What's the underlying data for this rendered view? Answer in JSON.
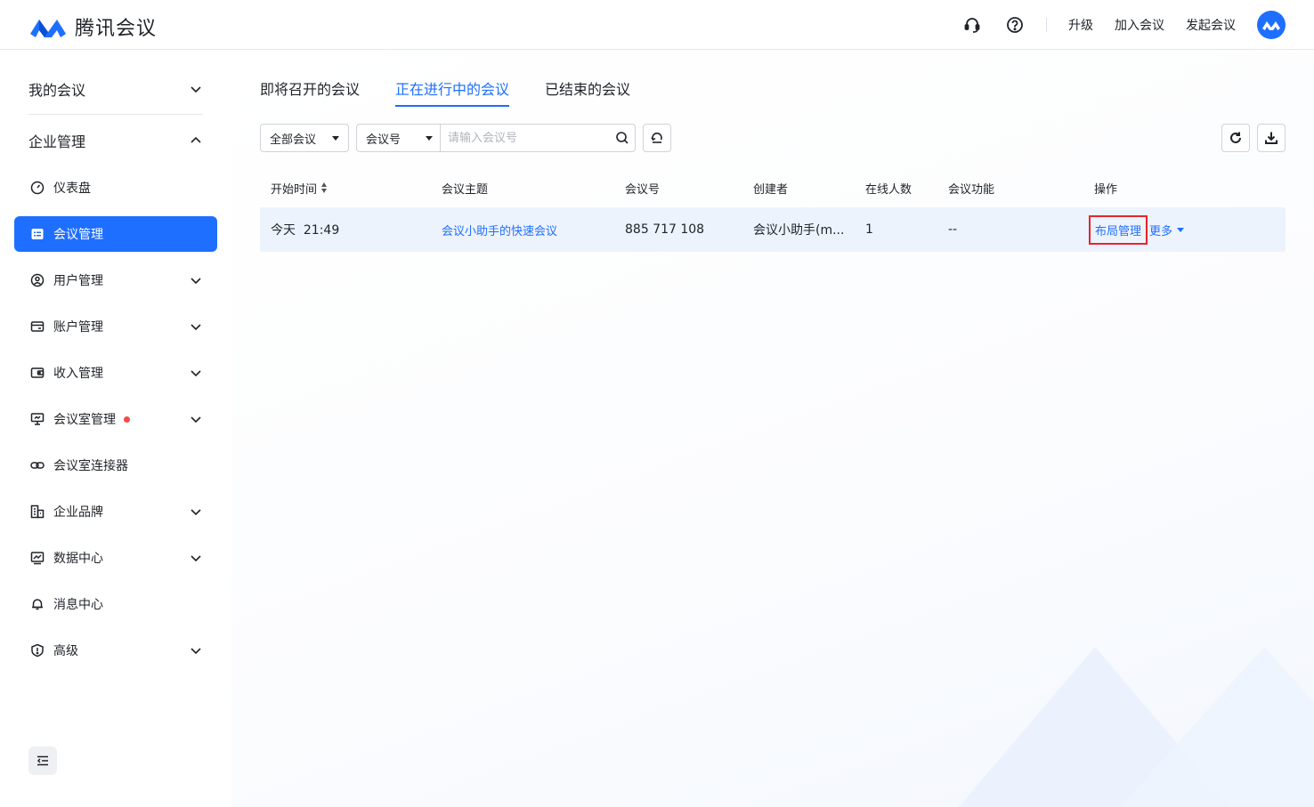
{
  "app": {
    "title": "腾讯会议"
  },
  "header": {
    "upgrade": "升级",
    "join": "加入会议",
    "start": "发起会议"
  },
  "sidebar": {
    "my_meetings": "我的会议",
    "enterprise": "企业管理",
    "items": [
      {
        "label": "仪表盘",
        "icon": "dashboard-icon"
      },
      {
        "label": "会议管理",
        "icon": "meeting-list-icon"
      },
      {
        "label": "用户管理",
        "icon": "user-icon"
      },
      {
        "label": "账户管理",
        "icon": "wallet-icon"
      },
      {
        "label": "收入管理",
        "icon": "income-icon"
      },
      {
        "label": "会议室管理",
        "icon": "room-icon"
      },
      {
        "label": "会议室连接器",
        "icon": "link-icon"
      },
      {
        "label": "企业品牌",
        "icon": "building-icon"
      },
      {
        "label": "数据中心",
        "icon": "chart-icon"
      },
      {
        "label": "消息中心",
        "icon": "bell-icon"
      },
      {
        "label": "高级",
        "icon": "shield-icon"
      }
    ]
  },
  "tabs": [
    "即将召开的会议",
    "正在进行中的会议",
    "已结束的会议"
  ],
  "active_tab": 1,
  "filters": {
    "scope": "全部会议",
    "search_type": "会议号",
    "search_placeholder": "请输入会议号"
  },
  "table": {
    "headers": [
      "开始时间",
      "会议主题",
      "会议号",
      "创建者",
      "在线人数",
      "会议功能",
      "操作"
    ],
    "rows": [
      {
        "start_time": "今天  21:49",
        "topic": "会议小助手的快速会议",
        "meeting_id": "885 717 108",
        "creator": "会议小助手(m...",
        "online": "1",
        "features": "--",
        "action_layout": "布局管理",
        "action_more": "更多"
      }
    ]
  },
  "colors": {
    "accent": "#1e6fff",
    "highlight_border": "#e5252a",
    "row_bg": "#edf3fd"
  }
}
